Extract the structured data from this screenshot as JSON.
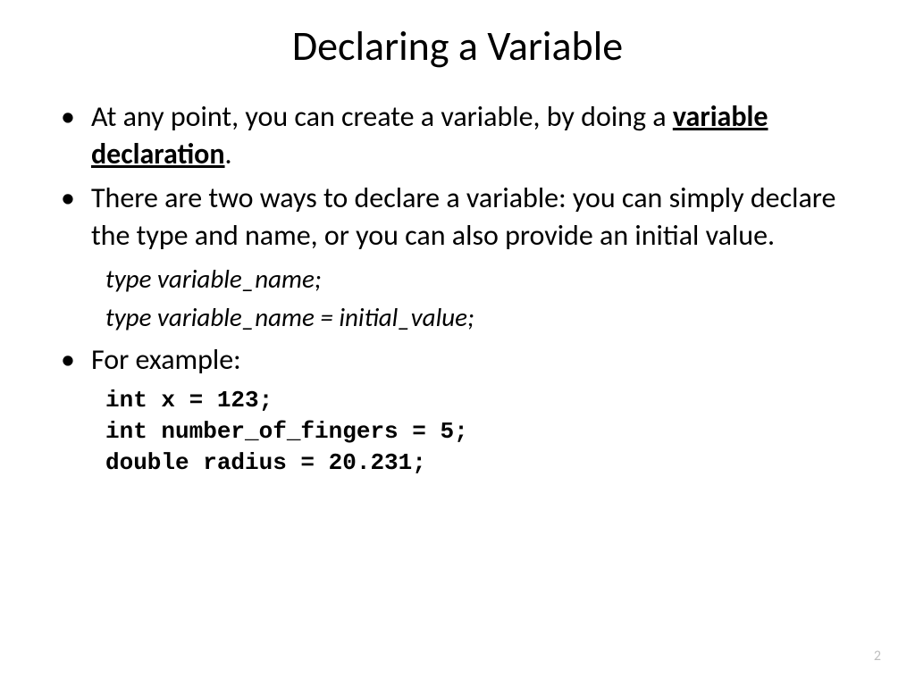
{
  "slide": {
    "title": "Declaring a Variable",
    "bullet1_prefix": "At any point, you can create a variable, by doing a ",
    "bullet1_bold": "variable declaration",
    "bullet1_suffix": ".",
    "bullet2": "There are two ways to declare a variable: you can simply declare the type and name, or you can also provide an initial value.",
    "syntax1": "type variable_name;",
    "syntax2": "type variable_name = initial_value;",
    "bullet3": "For example:",
    "example1": "int x = 123;",
    "example2": "int number_of_fingers = 5;",
    "example3": "double radius = 20.231;",
    "page_number": "2"
  }
}
